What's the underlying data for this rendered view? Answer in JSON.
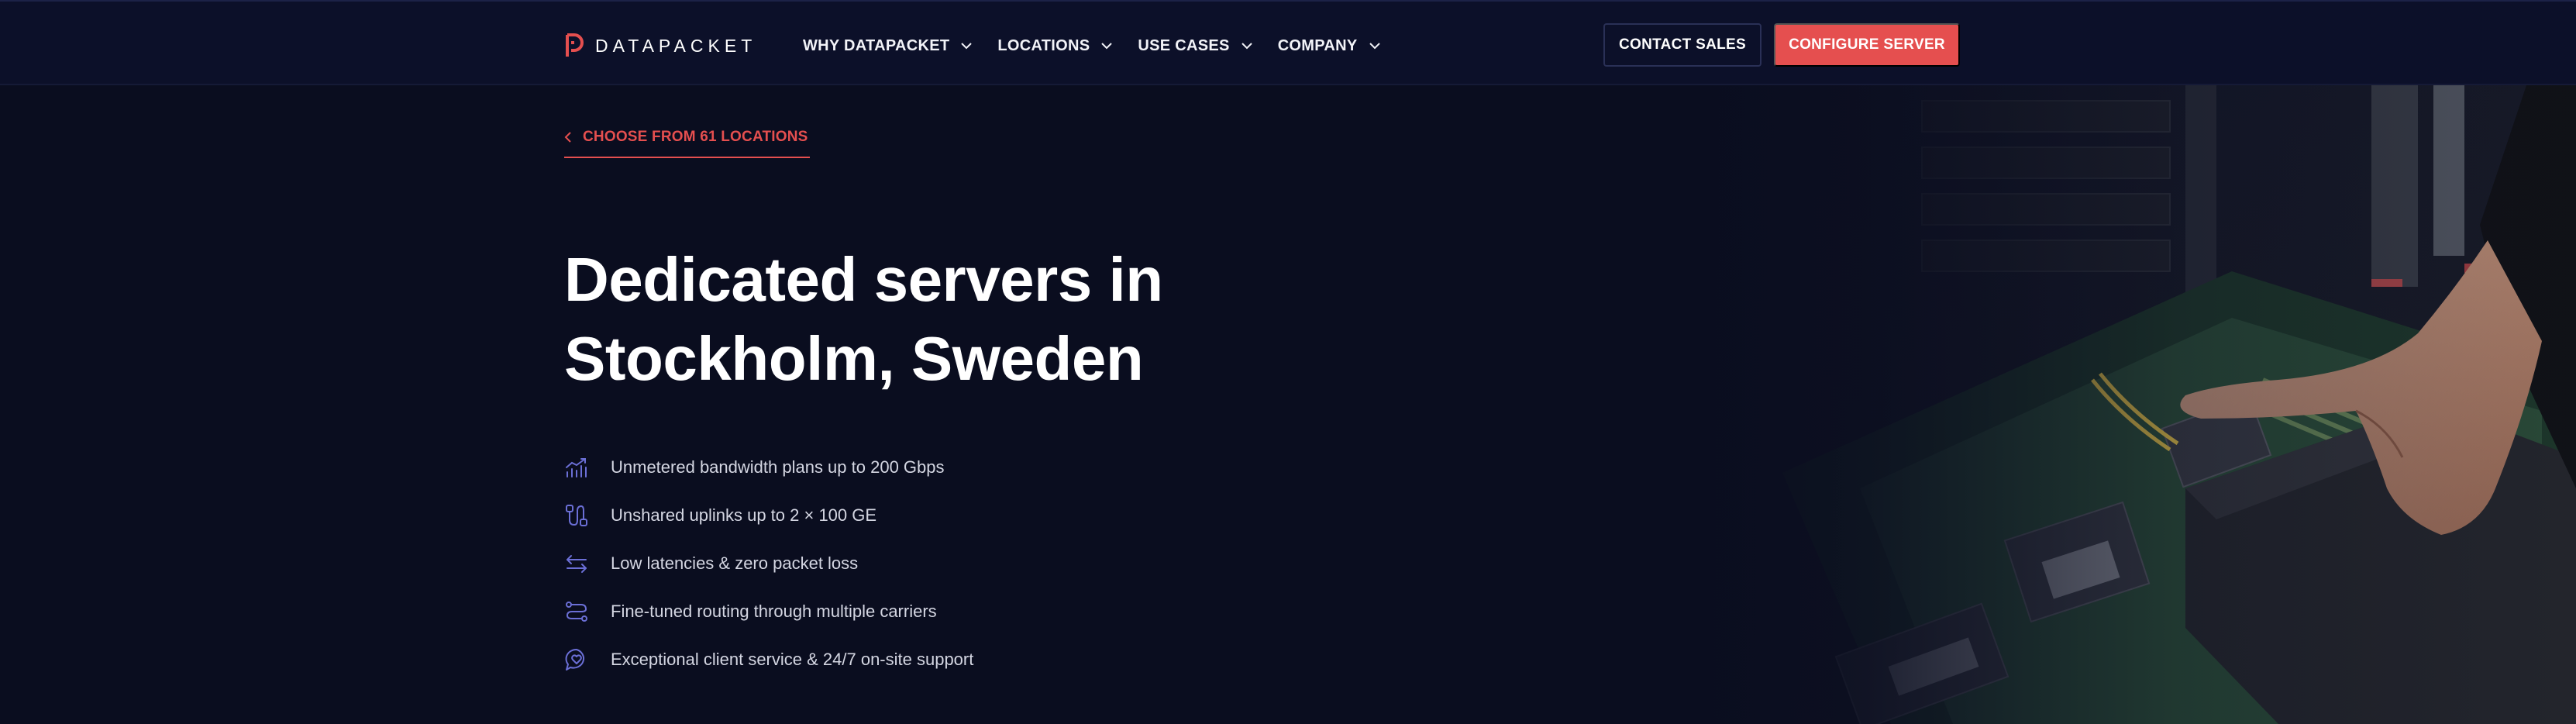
{
  "brand": {
    "name": "DATAPACKET",
    "accent": "#e54f4f",
    "icon_color": "#6b6fd6"
  },
  "nav": {
    "items": [
      {
        "label": "WHY DATAPACKET"
      },
      {
        "label": "LOCATIONS"
      },
      {
        "label": "USE CASES"
      },
      {
        "label": "COMPANY"
      }
    ],
    "contact_label": "CONTACT SALES",
    "configure_label": "CONFIGURE SERVER"
  },
  "hero": {
    "back_link": "CHOOSE FROM 61 LOCATIONS",
    "title_line1": "Dedicated servers in",
    "title_line2": "Stockholm, Sweden",
    "features": [
      {
        "icon": "bandwidth-chart-icon",
        "text": "Unmetered bandwidth plans up to 200 Gbps"
      },
      {
        "icon": "uplink-icon",
        "text": "Unshared uplinks up to 2 × 100 GE"
      },
      {
        "icon": "arrows-exchange-icon",
        "text": "Low latencies & zero packet loss"
      },
      {
        "icon": "routing-icon",
        "text": "Fine-tuned routing through multiple carriers"
      },
      {
        "icon": "support-chat-icon",
        "text": "Exceptional client service & 24/7 on-site support"
      }
    ]
  }
}
